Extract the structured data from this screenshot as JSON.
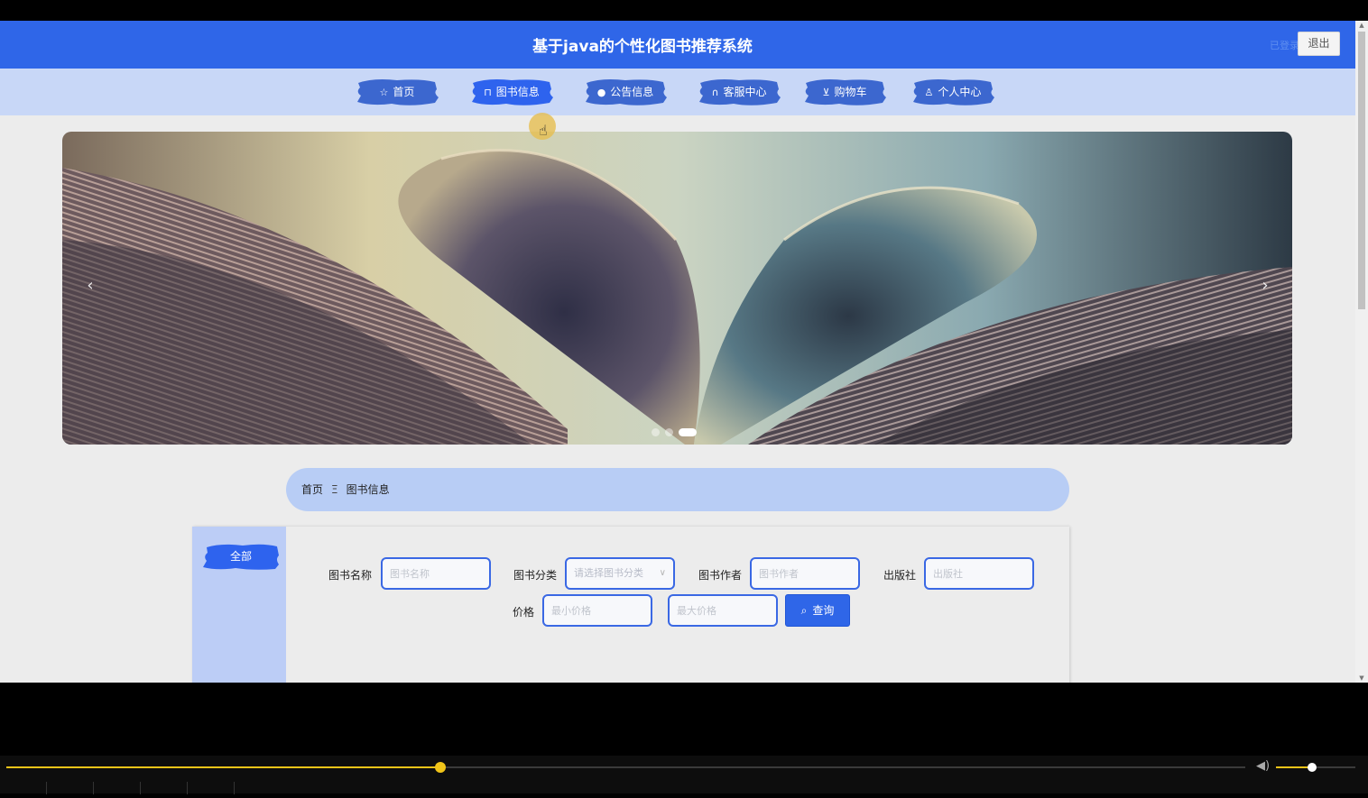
{
  "header": {
    "title": "基于java的个性化图书推荐系统",
    "user_text": "已登录",
    "logout_label": "退出",
    "bg_color": "#2f66e8"
  },
  "nav": {
    "items": [
      {
        "icon": "star-icon",
        "glyph": "☆",
        "label": "首页",
        "active": false
      },
      {
        "icon": "bag-icon",
        "glyph": "⊓",
        "label": "图书信息",
        "active": true
      },
      {
        "icon": "notice-icon",
        "glyph": "●",
        "label": "公告信息",
        "active": false
      },
      {
        "icon": "headset-icon",
        "glyph": "∩",
        "label": "客服中心",
        "active": false
      },
      {
        "icon": "cart-icon",
        "glyph": "⊻",
        "label": "购物车",
        "active": false
      },
      {
        "icon": "user-icon",
        "glyph": "♙",
        "label": "个人中心",
        "active": false
      }
    ]
  },
  "banner": {
    "prev": "‹",
    "next": "›",
    "slide_count": 3,
    "active_slide": 3
  },
  "breadcrumb": {
    "home": "首页",
    "separator": "Ξ",
    "current": "图书信息"
  },
  "sidebar": {
    "category_all": "全部"
  },
  "filters": {
    "book_name_label": "图书名称",
    "book_name_placeholder": "图书名称",
    "category_label": "图书分类",
    "category_placeholder": "请选择图书分类",
    "author_label": "图书作者",
    "author_placeholder": "图书作者",
    "publisher_label": "出版社",
    "publisher_placeholder": "出版社",
    "price_label": "价格",
    "min_price_placeholder": "最小价格",
    "max_price_placeholder": "最大价格",
    "search_label": "查询"
  },
  "player": {
    "progress": 0.35,
    "volume": 0.45,
    "accent": "#f0c419"
  }
}
